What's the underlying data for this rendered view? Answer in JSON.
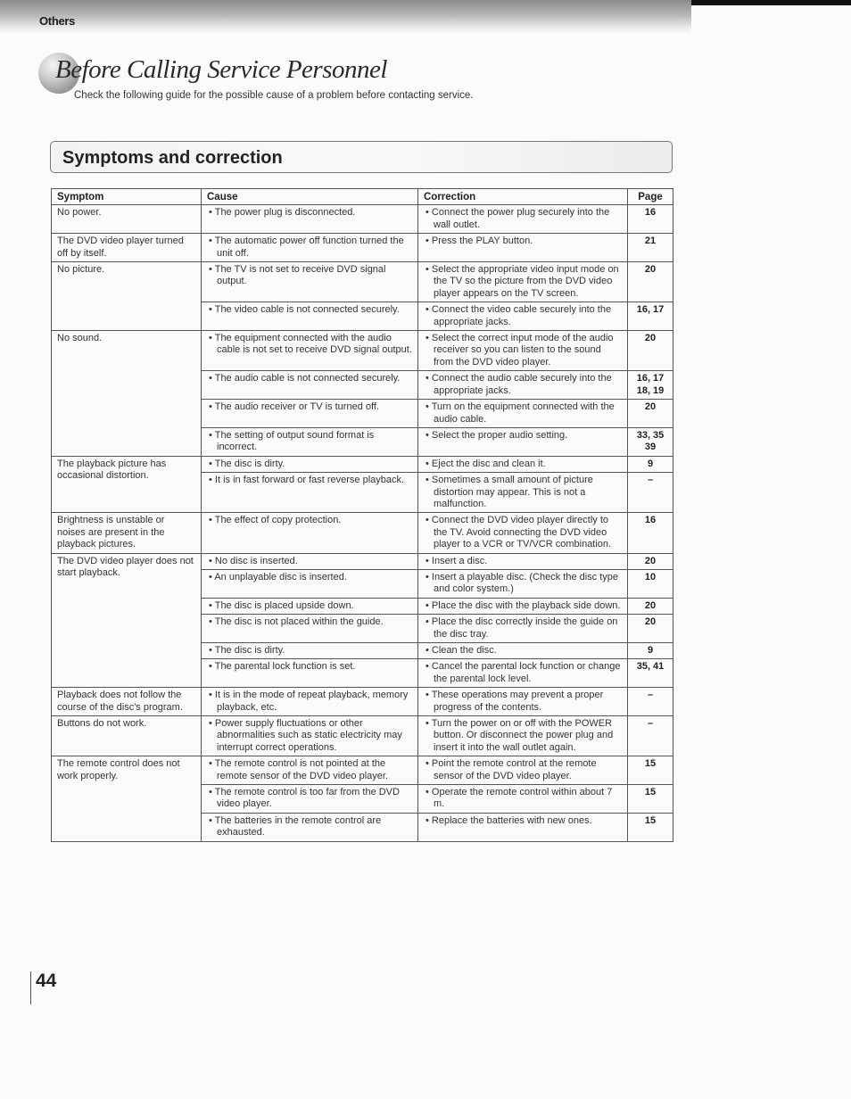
{
  "header": {
    "section_label": "Others"
  },
  "title": {
    "text": "Before Calling Service Personnel",
    "subtitle": "Check the following guide for the possible cause of a problem before contacting service."
  },
  "section": {
    "title": "Symptoms and correction"
  },
  "table": {
    "headers": [
      "Symptom",
      "Cause",
      "Correction",
      "Page"
    ],
    "groups": [
      {
        "symptom": "No power.",
        "rows": [
          {
            "cause": "The power plug is disconnected.",
            "correction": "Connect the power plug securely into the wall outlet.",
            "page": "16"
          }
        ]
      },
      {
        "symptom": "The DVD video player turned off by itself.",
        "rows": [
          {
            "cause": "The automatic power off function turned the unit off.",
            "correction": "Press the PLAY button.",
            "page": "21"
          }
        ]
      },
      {
        "symptom": "No picture.",
        "rows": [
          {
            "cause": "The TV is not set to receive DVD signal output.",
            "correction": "Select the appropriate video input mode on the TV so the picture from the DVD video player appears on the TV screen.",
            "page": "20"
          },
          {
            "cause": "The video cable is not connected securely.",
            "correction": "Connect the video cable securely into the appropriate jacks.",
            "page": "16, 17"
          }
        ]
      },
      {
        "symptom": "No sound.",
        "rows": [
          {
            "cause": "The equipment connected with the audio cable is not set to receive DVD signal output.",
            "correction": "Select the correct input mode of the audio receiver so you can listen to the sound from the DVD video player.",
            "page": "20"
          },
          {
            "cause": "The audio cable is not connected securely.",
            "correction": "Connect the audio cable securely into the appropriate jacks.",
            "page": "16, 17 18, 19"
          },
          {
            "cause": "The audio receiver or TV is turned off.",
            "correction": "Turn on the equipment connected with the audio cable.",
            "page": "20"
          },
          {
            "cause": "The setting of output sound format is incorrect.",
            "correction": "Select the proper audio setting.",
            "page": "33, 35 39"
          }
        ]
      },
      {
        "symptom": "The playback picture has occasional distortion.",
        "rows": [
          {
            "cause": "The disc is dirty.",
            "correction": "Eject the disc and clean it.",
            "page": "9"
          },
          {
            "cause": "It is in fast forward or fast reverse playback.",
            "correction": "Sometimes a small amount of picture distortion may appear. This is not a malfunction.",
            "page": "–"
          }
        ]
      },
      {
        "symptom": "Brightness is unstable or noises are present in the playback pictures.",
        "rows": [
          {
            "cause": "The effect of copy protection.",
            "correction": "Connect the DVD video player directly to the TV.  Avoid connecting the DVD video player to a VCR or TV/VCR combination.",
            "page": "16"
          }
        ]
      },
      {
        "symptom": "The DVD video player does not start playback.",
        "rows": [
          {
            "cause": "No disc is inserted.",
            "correction": "Insert a disc.",
            "page": "20"
          },
          {
            "cause": "An unplayable disc is inserted.",
            "correction": "Insert a playable disc. (Check the disc type and color system.)",
            "page": "10"
          },
          {
            "cause": "The disc is placed upside down.",
            "correction": "Place the disc with the playback side down.",
            "page": "20"
          },
          {
            "cause": "The disc is not placed within the guide.",
            "correction": "Place the disc correctly inside the guide on the disc tray.",
            "page": "20"
          },
          {
            "cause": "The disc is dirty.",
            "correction": "Clean the disc.",
            "page": "9"
          },
          {
            "cause": "The parental lock function is set.",
            "correction": "Cancel the parental lock function or change the parental lock level.",
            "page": "35, 41"
          }
        ]
      },
      {
        "symptom": "Playback does not follow the course of the disc's program.",
        "rows": [
          {
            "cause": "It is in the mode of repeat playback, memory playback, etc.",
            "correction": "These operations may prevent a proper progress of the contents.",
            "page": "–"
          }
        ]
      },
      {
        "symptom": "Buttons do not work.",
        "rows": [
          {
            "cause": "Power supply fluctuations or other abnormalities such as static electricity may interrupt correct operations.",
            "correction": "Turn the power on or off with the POWER button. Or disconnect the power plug and insert it into the wall outlet again.",
            "page": "–"
          }
        ]
      },
      {
        "symptom": "The remote control does not work properly.",
        "rows": [
          {
            "cause": "The remote control is not pointed at the remote sensor of the DVD video player.",
            "correction": "Point the remote control at the remote sensor of the DVD video player.",
            "page": "15"
          },
          {
            "cause": "The remote control is too far from the DVD video player.",
            "correction": "Operate the remote control within about 7 m.",
            "page": "15"
          },
          {
            "cause": "The batteries in the remote control are exhausted.",
            "correction": "Replace the batteries with new ones.",
            "page": "15"
          }
        ]
      }
    ]
  },
  "footer": {
    "page_number": "44"
  }
}
